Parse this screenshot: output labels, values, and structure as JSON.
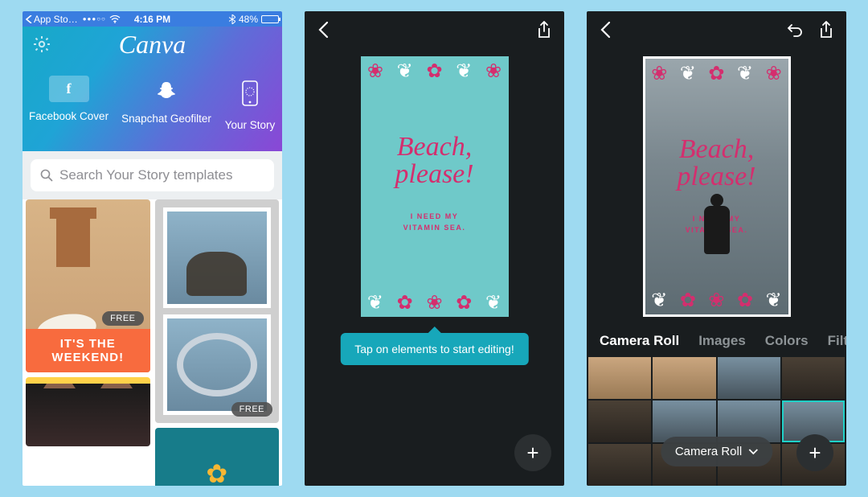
{
  "status_bar": {
    "back_label": "App Sto…",
    "carrier_dots": "●●●○○",
    "wifi_icon": "wifi-icon",
    "time": "4:16 PM",
    "bt_icon": "bluetooth-icon",
    "battery_pct": "48%"
  },
  "phone1": {
    "logo_text": "Canva",
    "design_types": [
      {
        "icon": "facebook-icon",
        "label": "Facebook Cover"
      },
      {
        "icon": "snapchat-icon",
        "label": "Snapchat Geofilter"
      },
      {
        "icon": "phone-icon",
        "label": "Your Story"
      }
    ],
    "search_placeholder": "Search Your Story templates",
    "templates": {
      "weekend_text": "IT'S THE\nWEEKEND!",
      "badge_free": "FREE"
    }
  },
  "phone2": {
    "canvas": {
      "title_line1": "Beach,",
      "title_line2": "please!",
      "sub_line1": "I NEED MY",
      "sub_line2": "VITAMIN SEA."
    },
    "tooltip_text": "Tap on elements to start editing!"
  },
  "phone3": {
    "canvas": {
      "title_line1": "Beach,",
      "title_line2": "please!",
      "sub_line1": "I NEED MY",
      "sub_line2": "VITAMIN SEA."
    },
    "tabs": [
      "Camera Roll",
      "Images",
      "Colors",
      "Filt"
    ],
    "active_tab": "Camera Roll",
    "roll_chip": "Camera Roll"
  },
  "colors": {
    "bg": "#9edaf1",
    "accent_pink": "#d42e6e",
    "accent_teal": "#17a7ba",
    "dark": "#191d1f"
  }
}
